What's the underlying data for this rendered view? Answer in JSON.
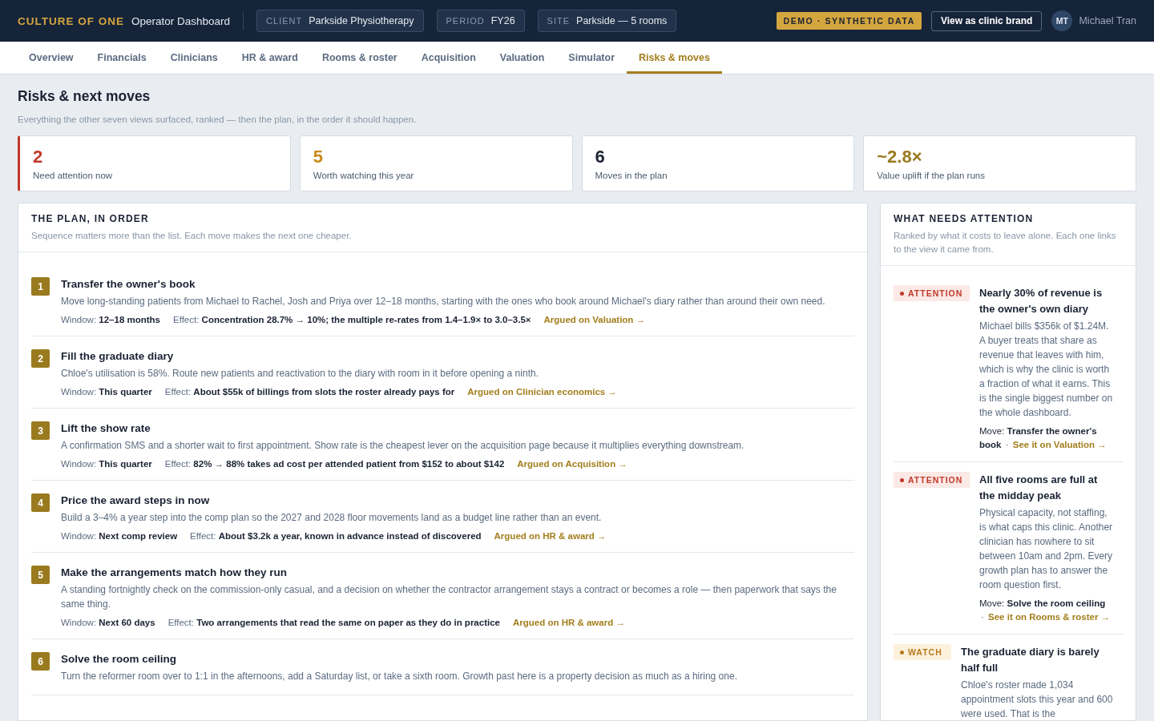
{
  "header": {
    "brand": "CULTURE OF ONE",
    "app_title": "Operator Dashboard",
    "context": [
      {
        "label": "CLIENT",
        "value": "Parkside Physiotherapy"
      },
      {
        "label": "PERIOD",
        "value": "FY26"
      },
      {
        "label": "SITE",
        "value": "Parkside — 5 rooms"
      }
    ],
    "demo_badge": "DEMO · SYNTHETIC DATA",
    "brand_button": "View as clinic brand",
    "user": {
      "initials": "MT",
      "name": "Michael Tran"
    }
  },
  "tabs": [
    {
      "label": "Overview",
      "selected": false
    },
    {
      "label": "Financials",
      "selected": false
    },
    {
      "label": "Clinicians",
      "selected": false
    },
    {
      "label": "HR & award",
      "selected": false
    },
    {
      "label": "Rooms & roster",
      "selected": false
    },
    {
      "label": "Acquisition",
      "selected": false
    },
    {
      "label": "Valuation",
      "selected": false
    },
    {
      "label": "Simulator",
      "selected": false
    },
    {
      "label": "Risks & moves",
      "selected": true
    }
  ],
  "page": {
    "title": "Risks & next moves",
    "subtitle": "Everything the other seven views surfaced, ranked — then the plan, in the order it should happen."
  },
  "stats": [
    {
      "value": "2",
      "label": "Need attention now",
      "color": "#c0392b",
      "flagged": true
    },
    {
      "value": "5",
      "label": "Worth watching this year",
      "color": "#c98a1b",
      "flagged": false
    },
    {
      "value": "6",
      "label": "Moves in the plan",
      "color": "#1a2233",
      "flagged": false
    },
    {
      "value": "~2.8×",
      "label": "Value uplift if the plan runs",
      "color": "#9a7a1e",
      "flagged": false
    }
  ],
  "plan": {
    "title": "THE PLAN, IN ORDER",
    "subtitle": "Sequence matters more than the list. Each move makes the next one cheaper.",
    "items": [
      {
        "number": "1",
        "title": "Transfer the owner's book",
        "body": "Move long-standing patients from Michael to Rachel, Josh and Priya over 12–18 months, starting with the ones who book around Michael's diary rather than around their own need.",
        "meta": {
          "window_label": "Window:",
          "window": "12–18 months",
          "effect_label": "Effect:",
          "effect": "Concentration 28.7% → 10%; the multiple re-rates from 1.4–1.9× to 3.0–3.5×",
          "link": "Argued on Valuation →"
        }
      },
      {
        "number": "2",
        "title": "Fill the graduate diary",
        "body": "Chloe's utilisation is 58%. Route new patients and reactivation to the diary with room in it before opening a ninth.",
        "meta": {
          "window_label": "Window:",
          "window": "This quarter",
          "effect_label": "Effect:",
          "effect": "About $55k of billings from slots the roster already pays for",
          "link": "Argued on Clinician economics →"
        }
      },
      {
        "number": "3",
        "title": "Lift the show rate",
        "body": "A confirmation SMS and a shorter wait to first appointment. Show rate is the cheapest lever on the acquisition page because it multiplies everything downstream.",
        "meta": {
          "window_label": "Window:",
          "window": "This quarter",
          "effect_label": "Effect:",
          "effect": "82% → 88% takes ad cost per attended patient from $152 to about $142",
          "link": "Argued on Acquisition →"
        }
      },
      {
        "number": "4",
        "title": "Price the award steps in now",
        "body": "Build a 3–4% a year step into the comp plan so the 2027 and 2028 floor movements land as a budget line rather than an event.",
        "meta": {
          "window_label": "Window:",
          "window": "Next comp review",
          "effect_label": "Effect:",
          "effect": "About $3.2k a year, known in advance instead of discovered",
          "link": "Argued on HR & award →"
        }
      },
      {
        "number": "5",
        "title": "Make the arrangements match how they run",
        "body": "A standing fortnightly check on the commission-only casual, and a decision on whether the contractor arrangement stays a contract or becomes a role — then paperwork that says the same thing.",
        "meta": {
          "window_label": "Window:",
          "window": "Next 60 days",
          "effect_label": "Effect:",
          "effect": "Two arrangements that read the same on paper as they do in practice",
          "link": "Argued on HR & award →"
        }
      },
      {
        "number": "6",
        "title": "Solve the room ceiling",
        "body": "Turn the reformer room over to 1:1 in the afternoons, add a Saturday list, or take a sixth room. Growth past here is a property decision as much as a hiring one."
      }
    ]
  },
  "attention": {
    "title": "WHAT NEEDS ATTENTION",
    "subtitle": "Ranked by what it costs to leave alone. Each one links to the view it came from.",
    "items": [
      {
        "kind": "attention",
        "label": "ATTENTION",
        "title": "Nearly 30% of revenue is the owner's own diary",
        "body": "Michael bills $356k of $1.24M. A buyer treats that share as revenue that leaves with him, which is why the clinic is worth a fraction of what it earns. This is the single biggest number on the whole dashboard.",
        "move_label": "Move:",
        "move": "Transfer the owner's book",
        "separator": "·",
        "link": "See it on Valuation →"
      },
      {
        "kind": "attention",
        "label": "ATTENTION",
        "title": "All five rooms are full at the midday peak",
        "body": "Physical capacity, not staffing, is what caps this clinic. Another clinician has nowhere to sit between 10am and 2pm. Every growth plan has to answer the room question first.",
        "move_label": "Move:",
        "move": "Solve the room ceiling",
        "separator": "·",
        "link": "See it on Rooms & roster →"
      },
      {
        "kind": "watch",
        "label": "WATCH",
        "title": "The graduate diary is barely half full",
        "body": "Chloe's roster made 1,034 appointment slots this year and 600 were used. That is the"
      }
    ]
  }
}
